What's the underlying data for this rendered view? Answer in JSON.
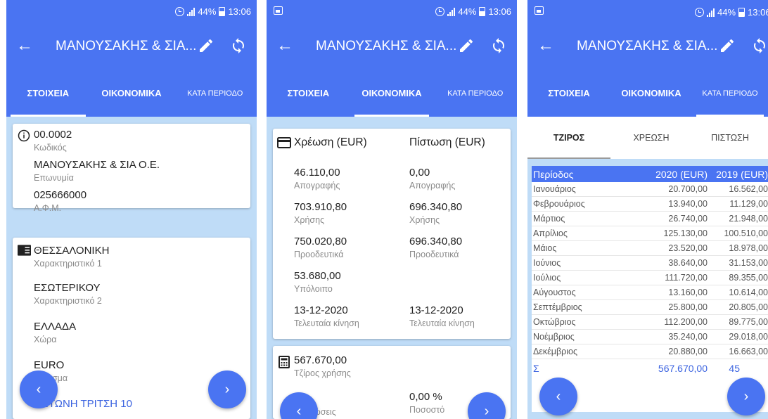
{
  "status": {
    "battery": "44%",
    "time": "13:06"
  },
  "app": {
    "title": "ΜΑΝΟΥΣΑΚΗΣ & ΣΙΑ..."
  },
  "tabs": [
    "ΣΤΟΙΧΕΙΑ",
    "ΟΙΚΟΝΟΜΙΚΑ",
    "ΚΑΤΑ ΠΕΡΙΟΔΟ"
  ],
  "screen1": {
    "card1": [
      {
        "value": "00.0002",
        "label": "Κωδικός"
      },
      {
        "value": "ΜΑΝΟΥΣΑΚΗΣ & ΣΙΑ Ο.Ε.",
        "label": "Επωνυμία"
      },
      {
        "value": "025666000",
        "label": "Α.Φ.Μ."
      }
    ],
    "card2": [
      {
        "value": "ΘΕΣΣΑΛΟΝΙΚΗ",
        "label": "Χαρακτηριστικό 1"
      },
      {
        "value": "ΕΣΩΤΕΡΙΚΟΥ",
        "label": "Χαρακτηριστικό 2"
      },
      {
        "value": "ΕΛΛΑΔΑ",
        "label": "Χώρα"
      },
      {
        "value": "EURO",
        "label": "Νόμισμα"
      },
      {
        "value": "ΑΝΤΩΝΗ ΤΡΙΤΣΗ 10"
      }
    ]
  },
  "screen2": {
    "debit_header": "Χρέωση (EUR)",
    "credit_header": "Πίστωση (EUR)",
    "rows": [
      {
        "debit": "46.110,00",
        "credit": "0,00",
        "label": "Απογραφής"
      },
      {
        "debit": "703.910,80",
        "credit": "696.340,80",
        "label": "Χρήσης"
      },
      {
        "debit": "750.020,80",
        "credit": "696.340,80",
        "label": "Προοδευτικά"
      }
    ],
    "balance": {
      "value": "53.680,00",
      "label": "Υπόλοιπο"
    },
    "last": {
      "debit": "13-12-2020",
      "credit": "13-12-2020",
      "label": "Τελευταία κίνηση"
    },
    "turnover": {
      "value": "567.670,00",
      "label": "Τζίρος χρήσης"
    },
    "discounts": {
      "label": "Εκπτώσεις"
    },
    "percent": {
      "value": "0,00 %",
      "label": "Ποσοστό"
    }
  },
  "screen3": {
    "subtabs": [
      "ΤΖΙΡΟΣ",
      "ΧΡΕΩΣΗ",
      "ΠΙΣΤΩΣΗ"
    ],
    "headers": [
      "Περίοδος",
      "2020 (EUR)",
      "2019 (EUR)"
    ],
    "rows": [
      [
        "Ιανουάριος",
        "20.700,00",
        "16.562,00"
      ],
      [
        "Φεβρουάριος",
        "13.940,00",
        "11.129,00"
      ],
      [
        "Μάρτιος",
        "26.740,00",
        "21.948,00"
      ],
      [
        "Απρίλιος",
        "125.130,00",
        "100.510,00"
      ],
      [
        "Μάιος",
        "23.520,00",
        "18.978,00"
      ],
      [
        "Ιούνιος",
        "38.640,00",
        "31.153,00"
      ],
      [
        "Ιούλιος",
        "111.720,00",
        "89.355,00"
      ],
      [
        "Αύγουστος",
        "13.160,00",
        "10.614,00"
      ],
      [
        "Σεπτέμβριος",
        "25.800,00",
        "20.805,00"
      ],
      [
        "Οκτώβριος",
        "112.200,00",
        "89.775,00"
      ],
      [
        "Νοέμβριος",
        "35.240,00",
        "29.018,00"
      ],
      [
        "Δεκέμβριος",
        "20.880,00",
        "16.663,00"
      ]
    ],
    "total": [
      "Σ",
      "567.670,00",
      "45"
    ]
  },
  "nav": {
    "prev": "‹",
    "next": "›"
  },
  "colors": {
    "primary": "#4a74f2",
    "background": "#bfdcf7",
    "link": "#3b63e0"
  }
}
